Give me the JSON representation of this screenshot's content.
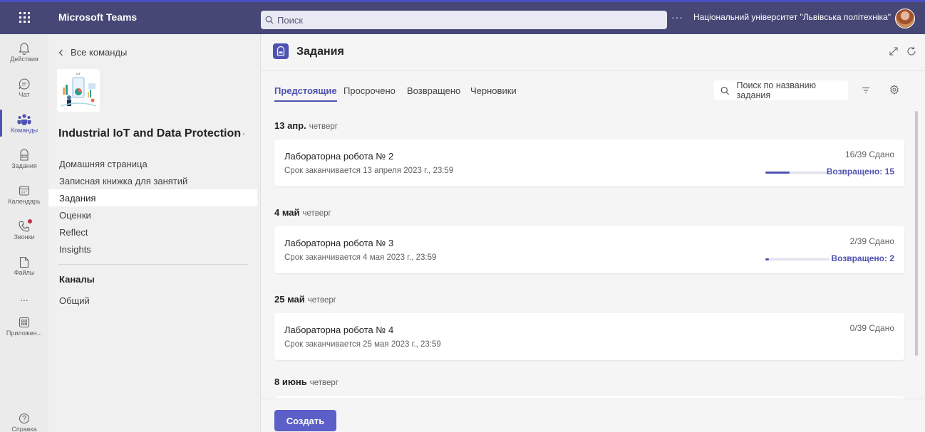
{
  "topbar": {
    "app_name": "Microsoft Teams",
    "search_placeholder": "Поиск",
    "more": "···",
    "org_name": "Національний університет \"Львівська політехніка\""
  },
  "rail": [
    {
      "label": "Действия",
      "icon": "bell-icon"
    },
    {
      "label": "Чат",
      "icon": "chat-icon"
    },
    {
      "label": "Команды",
      "icon": "teams-icon",
      "active": true
    },
    {
      "label": "Задания",
      "icon": "assignments-icon"
    },
    {
      "label": "Календарь",
      "icon": "calendar-icon"
    },
    {
      "label": "Звонки",
      "icon": "calls-icon",
      "notification": true
    },
    {
      "label": "Файлы",
      "icon": "files-icon"
    },
    {
      "label": "...",
      "icon": "more-apps-icon"
    },
    {
      "label": "Приложен...",
      "icon": "apps-icon"
    },
    {
      "label": "Справка",
      "icon": "help-icon"
    }
  ],
  "team_panel": {
    "back_label": "Все команды",
    "logo_text": "IoT",
    "team_name": "Industrial IoT and Data Protection",
    "team_more": "···",
    "nav": [
      {
        "label": "Домашняя страница"
      },
      {
        "label": "Записная книжка для занятий"
      },
      {
        "label": "Задания",
        "selected": true
      },
      {
        "label": "Оценки"
      },
      {
        "label": "Reflect"
      },
      {
        "label": "Insights"
      }
    ],
    "channels_heading": "Каналы",
    "channels": [
      {
        "label": "Общий"
      }
    ]
  },
  "main": {
    "title": "Задания",
    "tabs": [
      {
        "label": "Предстоящие",
        "active": true
      },
      {
        "label": "Просрочено"
      },
      {
        "label": "Возвращено"
      },
      {
        "label": "Черновики"
      }
    ],
    "search_placeholder": "Поиск по названию задания",
    "groups": [
      {
        "date": "13 апр.",
        "weekday": "четверг",
        "assignment": {
          "name": "Лабораторна робота № 2",
          "due": "Срок заканчивается 13 апреля 2023 г., 23:59",
          "submitted": "16/39 Сдано",
          "returned": "Возвращено: 15",
          "returned_fraction": 0.38
        }
      },
      {
        "date": "4 май",
        "weekday": "четверг",
        "assignment": {
          "name": "Лабораторна робота № 3",
          "due": "Срок заканчивается 4 мая 2023 г., 23:59",
          "submitted": "2/39 Сдано",
          "returned": "Возвращено: 2",
          "returned_fraction": 0.05
        }
      },
      {
        "date": "25 май",
        "weekday": "четверг",
        "assignment": {
          "name": "Лабораторна робота № 4",
          "due": "Срок заканчивается 25 мая 2023 г., 23:59",
          "submitted": "0/39 Сдано"
        }
      },
      {
        "date": "8 июнь",
        "weekday": "четверг"
      }
    ],
    "create_label": "Создать"
  },
  "colors": {
    "topbar": "#464775",
    "accent": "#4f52b2",
    "create_button": "#5b5fc7",
    "notification": "#c4314b"
  }
}
